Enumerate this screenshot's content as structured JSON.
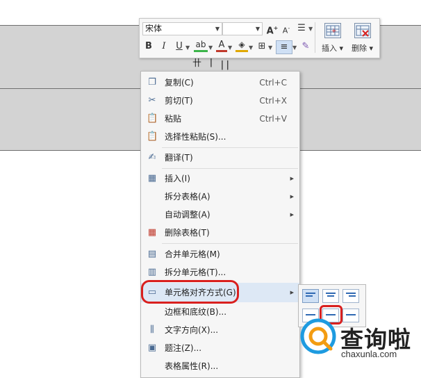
{
  "toolbar": {
    "font_name": "宋体",
    "font_size": "",
    "grow_font": "A",
    "shrink_font": "A",
    "bold": "B",
    "italic": "I",
    "underline": "U",
    "highlight": "ab",
    "font_color": "A",
    "insert_label": "插入",
    "delete_label": "删除"
  },
  "document": {
    "cursor_glyph_1": "卄",
    "cursor_glyph_2": "|",
    "cursor_glyph_3": "||"
  },
  "menu": {
    "items": [
      {
        "label": "复制(C)",
        "shortcut": "Ctrl+C",
        "icon": "copy-icon"
      },
      {
        "label": "剪切(T)",
        "shortcut": "Ctrl+X",
        "icon": "scissors-icon"
      },
      {
        "label": "粘贴",
        "shortcut": "Ctrl+V",
        "icon": "paste-icon"
      },
      {
        "label": "选择性粘贴(S)...",
        "shortcut": "",
        "icon": "paste-special-icon"
      },
      {
        "label": "翻译(T)",
        "shortcut": "",
        "icon": "translate-icon"
      },
      {
        "label": "插入(I)",
        "shortcut": "",
        "icon": "table-insert-icon"
      },
      {
        "label": "拆分表格(A)",
        "shortcut": "",
        "icon": ""
      },
      {
        "label": "自动调整(A)",
        "shortcut": "",
        "icon": ""
      },
      {
        "label": "删除表格(T)",
        "shortcut": "",
        "icon": "delete-table-icon"
      },
      {
        "label": "合并单元格(M)",
        "shortcut": "",
        "icon": "merge-cells-icon"
      },
      {
        "label": "拆分单元格(T)...",
        "shortcut": "",
        "icon": "split-cells-icon"
      },
      {
        "label": "单元格对齐方式(G)",
        "shortcut": "",
        "icon": "cell-align-icon"
      },
      {
        "label": "边框和底纹(B)...",
        "shortcut": "",
        "icon": ""
      },
      {
        "label": "文字方向(X)...",
        "shortcut": "",
        "icon": "text-direction-icon"
      },
      {
        "label": "题注(Z)...",
        "shortcut": "",
        "icon": "caption-icon"
      },
      {
        "label": "表格属性(R)...",
        "shortcut": "",
        "icon": ""
      }
    ]
  },
  "watermark": {
    "brand": "查询啦",
    "url": "chaxunla.com",
    "accent_color": "#1e9be0",
    "highlight_color": "#d9201e"
  }
}
